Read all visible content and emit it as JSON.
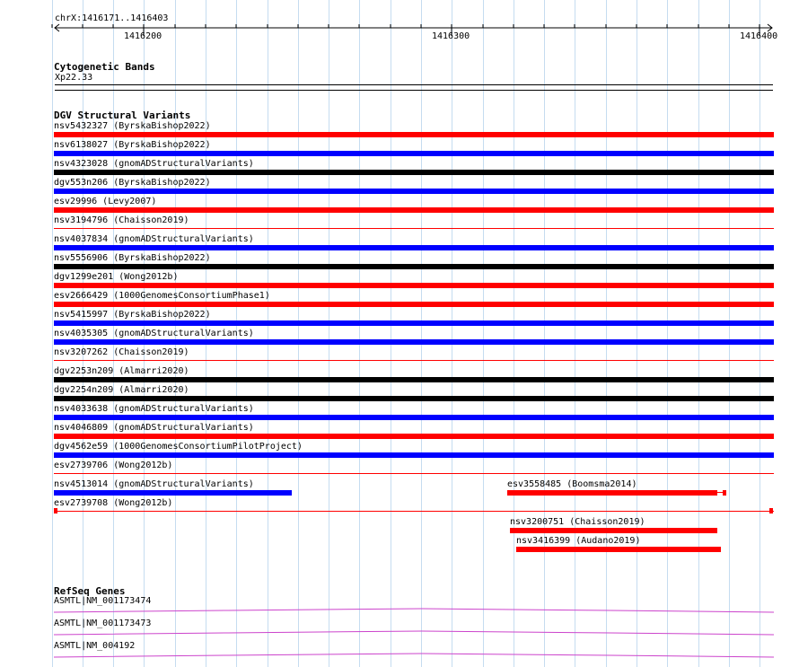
{
  "ruler": {
    "location": "chrX:1416171..1416403",
    "ticks": [
      "1416200",
      "1416300",
      "1416400"
    ]
  },
  "cytobands": {
    "title": "Cytogenetic Bands",
    "band": "Xp22.33"
  },
  "dgv": {
    "title": "DGV Structural Variants",
    "colors": {
      "red": "#ff0000",
      "blue": "#0000ff",
      "black": "#000000"
    },
    "features": [
      {
        "label": "nsv5432327 (ByrskaBishop2022)",
        "color": "red"
      },
      {
        "label": "nsv6138027 (ByrskaBishop2022)",
        "color": "blue"
      },
      {
        "label": "nsv4323028 (gnomADStructuralVariants)",
        "color": "black"
      },
      {
        "label": "dgv553n206 (ByrskaBishop2022)",
        "color": "blue"
      },
      {
        "label": "esv29996 (Levy2007)",
        "color": "red"
      },
      {
        "label": "nsv3194796 (Chaisson2019)",
        "color": "red"
      },
      {
        "label": "nsv4037834 (gnomADStructuralVariants)",
        "color": "blue"
      },
      {
        "label": "nsv5556906 (ByrskaBishop2022)",
        "color": "black"
      },
      {
        "label": "dgv1299e201 (Wong2012b)",
        "color": "red"
      },
      {
        "label": "esv2666429 (1000GenomesConsortiumPhase1)",
        "color": "red"
      },
      {
        "label": "nsv5415997 (ByrskaBishop2022)",
        "color": "blue"
      },
      {
        "label": "nsv4035305 (gnomADStructuralVariants)",
        "color": "blue"
      },
      {
        "label": "nsv3207262 (Chaisson2019)",
        "color": "red"
      },
      {
        "label": "dgv2253n209 (Almarri2020)",
        "color": "black"
      },
      {
        "label": "dgv2254n209 (Almarri2020)",
        "color": "black"
      },
      {
        "label": "nsv4033638 (gnomADStructuralVariants)",
        "color": "blue"
      },
      {
        "label": "nsv4046809 (gnomADStructuralVariants)",
        "color": "red"
      },
      {
        "label": "dgv4562e59 (1000GenomesConsortiumPilotProject)",
        "color": "blue"
      },
      {
        "label": "esv2739706 (Wong2012b)",
        "color": "red"
      },
      {
        "label": "nsv4513014 (gnomADStructuralVariants)",
        "color": "blue"
      },
      {
        "label": "esv3558485 (Boomsma2014)",
        "color": "red"
      },
      {
        "label": "esv2739708 (Wong2012b)",
        "color": "red"
      },
      {
        "label": "nsv3200751 (Chaisson2019)",
        "color": "red"
      },
      {
        "label": "nsv3416399 (Audano2019)",
        "color": "red"
      }
    ]
  },
  "refseq": {
    "title": "RefSeq Genes",
    "color": "#cc44cc",
    "genes": [
      {
        "label": "ASMTL|NM_001173474"
      },
      {
        "label": "ASMTL|NM_001173473"
      },
      {
        "label": "ASMTL|NM_004192"
      }
    ]
  }
}
